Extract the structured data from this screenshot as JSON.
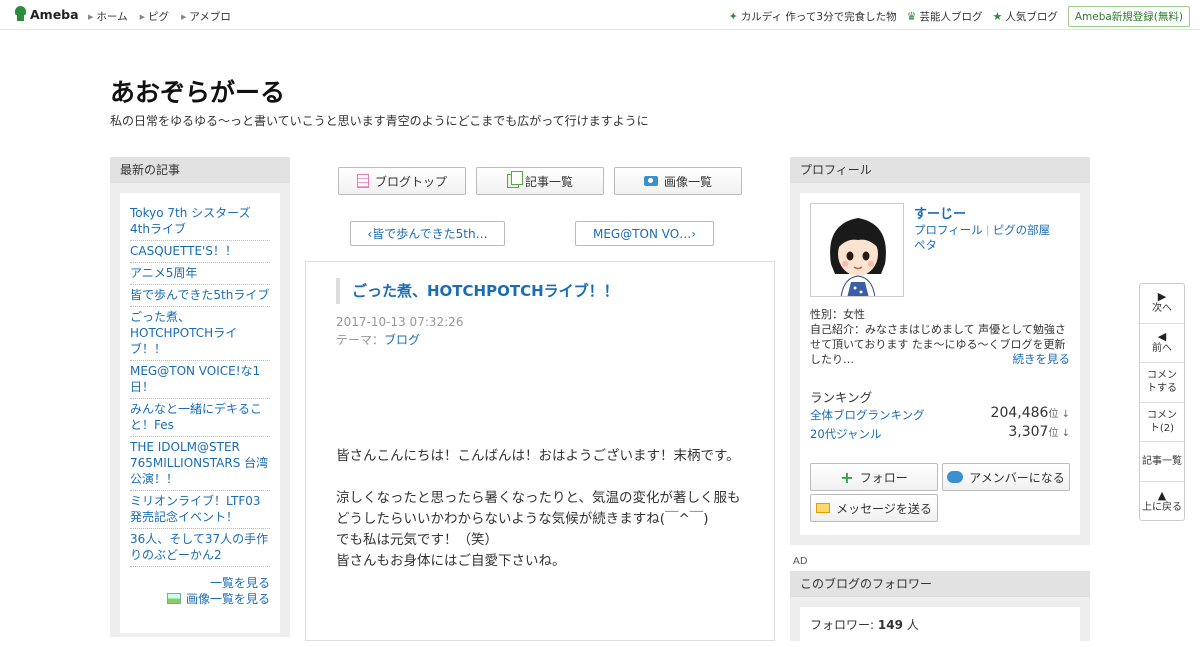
{
  "topbar": {
    "logo": "Ameba",
    "nav": [
      "ホーム",
      "ピグ",
      "アメブロ"
    ],
    "right_links": [
      {
        "label": "カルディ 作って3分で完食した物",
        "icon": "sparkle-icon"
      },
      {
        "label": "芸能人ブログ",
        "icon": "crown-icon"
      },
      {
        "label": "人気ブログ",
        "icon": "star-icon"
      }
    ],
    "signup": "Ameba新規登録(無料)"
  },
  "header": {
    "title": "あおぞらがーる",
    "description": "私の日常をゆるゆる～っと書いていこうと思います青空のようにどこまでも広がって行けますように"
  },
  "latest": {
    "heading": "最新の記事",
    "items": [
      "Tokyo 7th シスターズ4thライブ",
      "CASQUETTE'S！！",
      "アニメ5周年",
      "皆で歩んできた5thライブ",
      "ごった煮、HOTCHPOTCHライブ！！",
      "MEG@TON VOICE!な1日！",
      "みんなと一緒にデキること！Fes",
      "THE IDOLM@STER 765MILLIONSTARS 台湾公演！！",
      "ミリオンライブ！LTF03発売記念イベント！",
      "36人、そして37人の手作りのぶどーかん2"
    ],
    "see_all": "一覧を見る",
    "see_images": "画像一覧を見る"
  },
  "tabs": {
    "blog_top": "ブログトップ",
    "article_list": "記事一覧",
    "image_list": "画像一覧"
  },
  "pager": {
    "prev": "皆で歩んできた5th…",
    "next": "MEG@TON VO…"
  },
  "article": {
    "title": "ごった煮、HOTCHPOTCHライブ！！",
    "date": "2017-10-13 07:32:26",
    "theme_label": "テーマ：",
    "theme": "ブログ",
    "para1": "皆さんこんにちは！こんばんは！おはようございます！末柄です。",
    "para2a": "涼しくなったと思ったら暑くなったりと、気温の変化が著しく服もどうしたらいいかわからないような気候が続きますね(￣^￣)",
    "para2b": "でも私は元気です！（笑）",
    "para2c": "皆さんもお身体にはご自愛下さいね。"
  },
  "profile": {
    "heading": "プロフィール",
    "username": "すーじー",
    "link_profile": "プロフィール",
    "link_room": "ピグの部屋",
    "link_peta": "ペタ",
    "gender": "性別：女性",
    "intro": "自己紹介：みなさまはじめまして 声優として勉強させて頂いております たま～にゆる～くブログを更新したり…",
    "read_more": "続きを見る",
    "ranking_title": "ランキング",
    "rank_overall_label": "全体ブログランキング",
    "rank_overall_value": "204,486",
    "rank_genre_label": "20代ジャンル",
    "rank_genre_value": "3,307",
    "rank_unit": "位 ↓",
    "follow": "フォロー",
    "member": "アメンバーになる",
    "message": "メッセージを送る"
  },
  "ad_label": "AD",
  "followers": {
    "heading": "このブログのフォロワー",
    "label": "フォロワー:",
    "count": "149",
    "unit": "人"
  },
  "floatnav": {
    "next": "次へ",
    "prev": "前へ",
    "comment_do": "コメントする",
    "comment_count": "コメント(2)",
    "article_list": "記事一覧",
    "top": "上に戻る"
  }
}
